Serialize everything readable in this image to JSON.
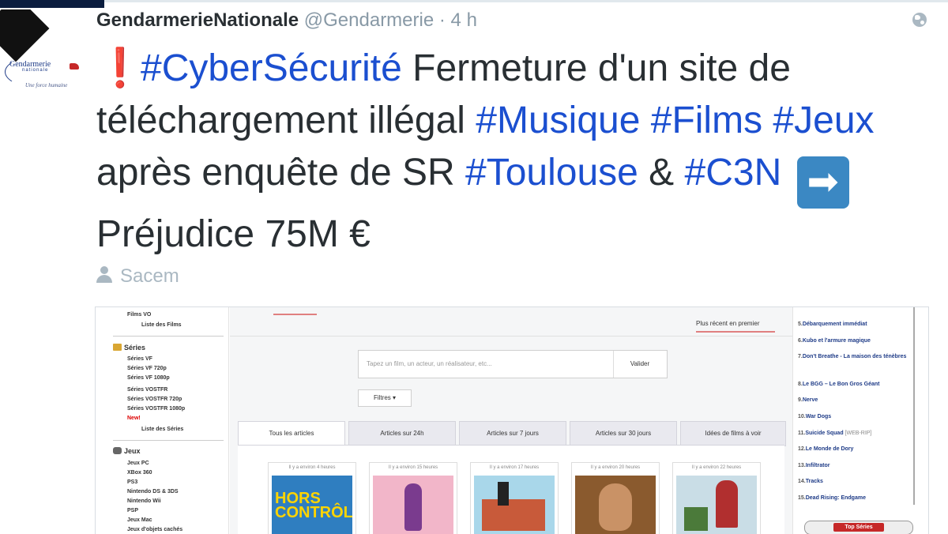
{
  "tweet": {
    "author_name": "GendarmerieNationale",
    "handle": "@Gendarmerie",
    "separator": "·",
    "time": "4 h",
    "avatar_text": "Gendarmerie",
    "avatar_sub": "nationale",
    "avatar_motto": "Une force humaine",
    "exclaim": "❗",
    "segments": {
      "h1": "#CyberSécurité",
      "t1": " Fermeture d'un site de téléchargement illégal ",
      "h2": "#Musique",
      "t2": " ",
      "h3": "#Films",
      "t3": " ",
      "h4": "#Jeux",
      "t4": " après enquête de SR ",
      "h5": "#Toulouse",
      "t5": " & ",
      "h6": "#C3N",
      "t6": " ",
      "arrow": "➡",
      "t7": "Préjudice 75M €"
    },
    "location": "Sacem"
  },
  "screenshot": {
    "sidebar": {
      "films_vo": "Films VO",
      "films_list": "Liste des Films",
      "series_head": "Séries",
      "series_items": [
        "Séries VF",
        "Séries VF 720p",
        "Séries VF 1080p",
        "Séries VOSTFR",
        "Séries VOSTFR 720p",
        "Séries VOSTFR 1080p"
      ],
      "series_new": "New!",
      "series_list": "Liste des Séries",
      "jeux_head": "Jeux",
      "jeux_items": [
        "Jeux PC",
        "XBox 360",
        "PS3",
        "Nintendo DS & 3DS",
        "Nintendo Wii",
        "PSP",
        "Jeux Mac",
        "Jeux d'objets cachés"
      ]
    },
    "main": {
      "sort_label": "Plus récent en premier",
      "search_placeholder": "Tapez un film, un acteur, un réalisateur, etc...",
      "search_button": "Valider",
      "filter_label": "Filtres ▾",
      "tabs": [
        "Tous les articles",
        "Articles sur 24h",
        "Articles sur 7 jours",
        "Articles sur 30 jours",
        "Idées de films à voir"
      ],
      "cards": [
        {
          "when": "Il y a environ 4 heures",
          "poster_title": "HORS CONTRÔLE"
        },
        {
          "when": "Il y a environ 15 heures"
        },
        {
          "when": "Il y a environ 17 heures"
        },
        {
          "when": "Il y a environ 20 heures"
        },
        {
          "when": "Il y a environ 22 heures"
        }
      ]
    },
    "right": {
      "items": [
        {
          "num": "5.",
          "title": "Débarquement immédiat"
        },
        {
          "num": "6.",
          "title": "Kubo et l'armure magique"
        },
        {
          "num": "7.",
          "title": "Don't Breathe - La maison des ténèbres"
        },
        {
          "num": "8.",
          "title": "Le BGG – Le Bon Gros Géant"
        },
        {
          "num": "9.",
          "title": "Nerve"
        },
        {
          "num": "10.",
          "title": "War Dogs"
        },
        {
          "num": "11.",
          "title": "Suicide Squad",
          "sub": "[WEB-RIP]"
        },
        {
          "num": "12.",
          "title": "Le Monde de Dory"
        },
        {
          "num": "13.",
          "title": "Infiltrator"
        },
        {
          "num": "14.",
          "title": "Tracks"
        },
        {
          "num": "15.",
          "title": "Dead Rising: Endgame"
        }
      ],
      "top_series": "Top Séries"
    }
  }
}
